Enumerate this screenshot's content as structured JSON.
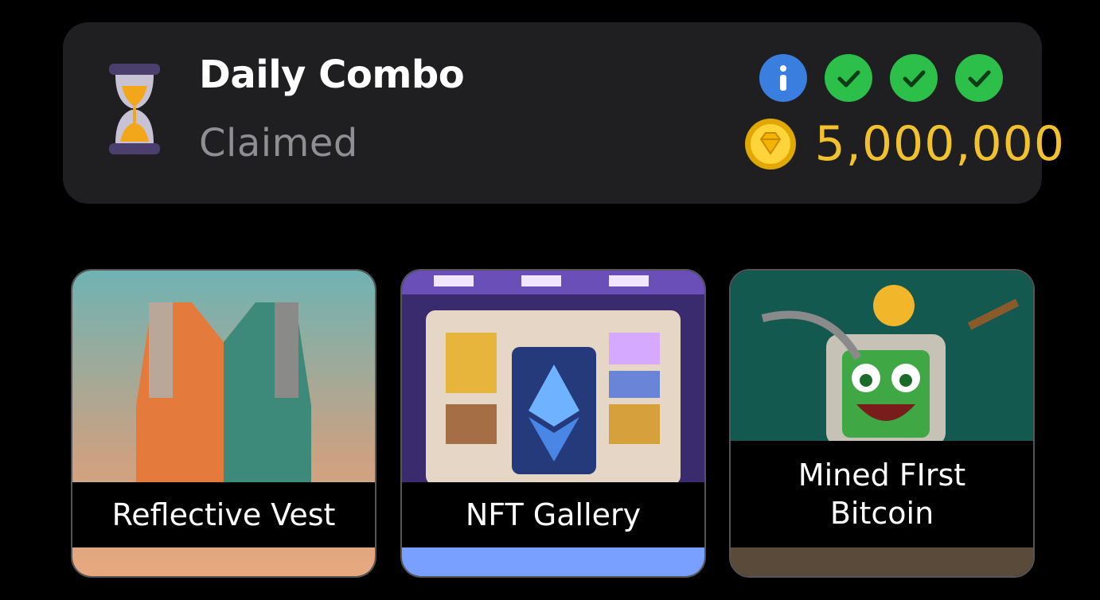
{
  "daily_combo": {
    "title": "Daily Combo",
    "status": "Claimed",
    "reward": "5,000,000",
    "info_icon": "info-icon",
    "check_icons": [
      "check-icon",
      "check-icon",
      "check-icon"
    ],
    "coin_icon": "coin-icon",
    "colors": {
      "reward": "#f2c12e",
      "check": "#2cc04a",
      "info": "#3a7fe0",
      "panel": "#1f1f21"
    }
  },
  "cards": [
    {
      "label": "Reflective Vest"
    },
    {
      "label": "NFT Gallery"
    },
    {
      "label": "Mined FIrst\nBitcoin"
    }
  ]
}
